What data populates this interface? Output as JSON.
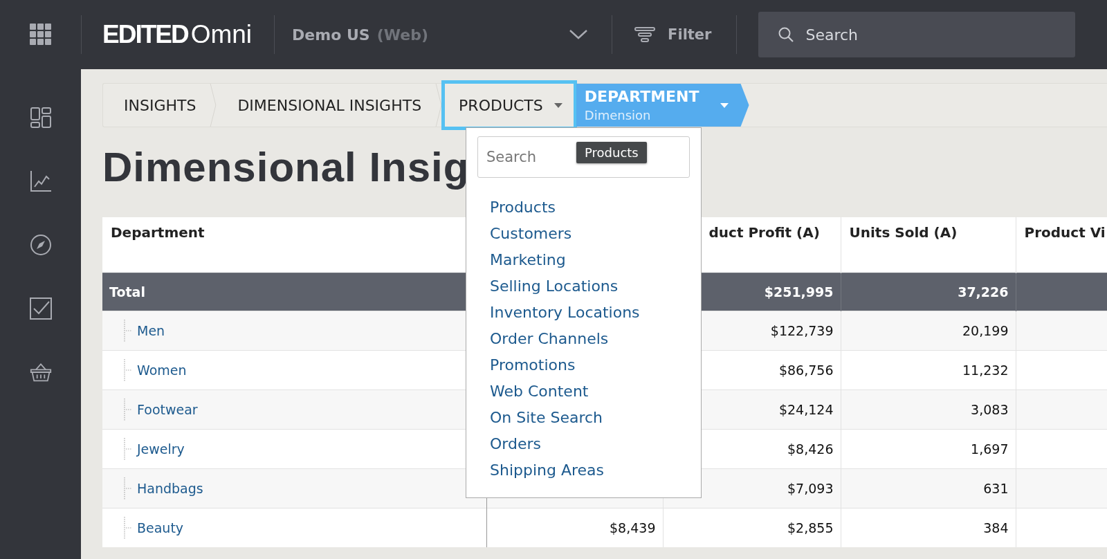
{
  "top_bar": {
    "logo": {
      "brand": "EDITED",
      "product": "Omni"
    },
    "workspace": {
      "name": "Demo US",
      "channel": "(Web)"
    },
    "filter_button": "Filter",
    "search": {
      "placeholder": "Search"
    }
  },
  "breadcrumbs": [
    {
      "kind": "crumb",
      "label": "INSIGHTS",
      "highlighted": false
    },
    {
      "kind": "crumb",
      "label": "DIMENSIONAL INSIGHTS",
      "highlighted": false
    },
    {
      "kind": "dropdown",
      "label": "PRODUCTS",
      "highlighted": true
    },
    {
      "kind": "dimension",
      "label": "DEPARTMENT",
      "sublabel": "Dimension",
      "highlighted": false
    }
  ],
  "page_title": "Dimensional Insig",
  "dimension_menu": {
    "search": {
      "placeholder": "Search"
    },
    "tooltip": "Products",
    "items": [
      "Products",
      "Customers",
      "Marketing",
      "Selling Locations",
      "Inventory Locations",
      "Order Channels",
      "Promotions",
      "Web Content",
      "On Site Search",
      "Orders",
      "Shipping Areas"
    ]
  },
  "table": {
    "columns": {
      "department": "Department",
      "column_3": "duct Profit (A)",
      "units_sold": "Units Sold (A)",
      "column_5": "Product Vi"
    },
    "rows": [
      {
        "kind": "total",
        "department": "Total",
        "column_3": "$251,995",
        "units_sold": "37,226"
      },
      {
        "kind": "item",
        "department": "Men",
        "column_3": "$122,739",
        "units_sold": "20,199"
      },
      {
        "kind": "item",
        "department": "Women",
        "column_3": "$86,756",
        "units_sold": "11,232"
      },
      {
        "kind": "item",
        "department": "Footwear",
        "column_3": "$24,124",
        "units_sold": "3,083"
      },
      {
        "kind": "item",
        "department": "Jewelry",
        "column_3": "$8,426",
        "units_sold": "1,697"
      },
      {
        "kind": "item",
        "department": "Handbags",
        "column_3": "$7,093",
        "units_sold": "631"
      },
      {
        "kind": "item",
        "department": "Beauty",
        "column_2": "$8,439",
        "column_3": "$2,855",
        "units_sold": "384"
      }
    ]
  }
}
